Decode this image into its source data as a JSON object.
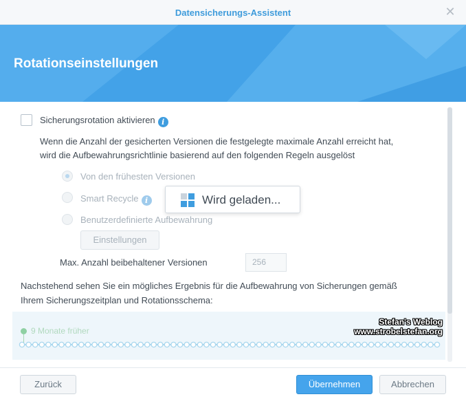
{
  "window": {
    "title": "Datensicherungs-Assistent"
  },
  "banner": {
    "heading": "Rotationseinstellungen"
  },
  "rotation": {
    "checkbox_label": "Sicherungsrotation aktivieren",
    "description_line1": "Wenn die Anzahl der gesicherten Versionen die festgelegte maximale Anzahl erreicht hat,",
    "description_line2": "wird die Aufbewahrungsrichtlinie basierend auf den folgenden Regeln ausgelöst",
    "options": [
      {
        "label": "Von den frühesten Versionen",
        "selected": true
      },
      {
        "label": "Smart Recycle",
        "selected": false
      },
      {
        "label": "Benutzerdefinierte Aufbewahrung",
        "selected": false
      }
    ],
    "settings_button": "Einstellungen",
    "max_versions_label": "Max. Anzahl beibehaltener Versionen",
    "max_versions_value": "256",
    "result_text_line1": "Nachstehend sehen Sie ein mögliches Ergebnis für die Aufbewahrung von Sicherungen gemäß",
    "result_text_line2": "Ihrem Sicherungszeitplan und Rotationsschema:"
  },
  "timeline": {
    "label": "9 Monate früher",
    "version_count": 64
  },
  "watermark": {
    "line1": "Stefan's Weblog",
    "line2": "www.strobelstefan.org"
  },
  "loading": {
    "text": "Wird geladen..."
  },
  "footer": {
    "back": "Zurück",
    "apply": "Übernehmen",
    "cancel": "Abbrechen"
  },
  "colors": {
    "accent": "#3e9bdb",
    "banner": "#4aa7ea",
    "primary_button": "#45a4ec",
    "timeline_dot": "#8fd0a3"
  },
  "icons": {
    "close": "close-icon",
    "info": "info-icon",
    "loading": "loading-grid-icon"
  }
}
